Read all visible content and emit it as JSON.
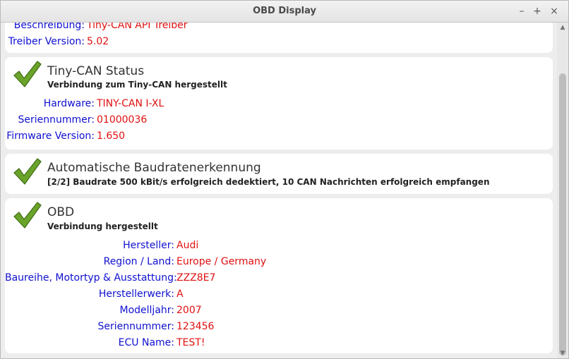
{
  "window": {
    "title": "OBD Display",
    "minimize": "–",
    "maximize": "+",
    "close": "×"
  },
  "driver": {
    "rows": [
      {
        "label": "Beschreibung:",
        "value": "Tiny-CAN API Treiber"
      },
      {
        "label": "Treiber Version:",
        "value": "5.02"
      }
    ]
  },
  "tinycan": {
    "title": "Tiny-CAN Status",
    "subtitle": "Verbindung zum Tiny-CAN hergestellt",
    "rows": [
      {
        "label": "Hardware:",
        "value": "TINY-CAN I-XL"
      },
      {
        "label": "Seriennummer:",
        "value": "01000036"
      },
      {
        "label": "Firmware Version:",
        "value": "1.650"
      }
    ]
  },
  "baud": {
    "title": "Automatische Baudratenerkennung",
    "subtitle": "[2/2] Baudrate 500 kBit/s erfolgreich dedektiert, 10 CAN Nachrichten erfolgreich empfangen"
  },
  "obd": {
    "title": "OBD",
    "subtitle": "Verbindung hergestellt",
    "rows": [
      {
        "label": "Hersteller:",
        "value": "Audi"
      },
      {
        "label": "Region / Land:",
        "value": "Europe / Germany"
      },
      {
        "label": "Baureihe, Motortyp & Ausstattung:",
        "value": "ZZZ8E7"
      },
      {
        "label": "Herstellerwerk:",
        "value": "A"
      },
      {
        "label": "Modelljahr:",
        "value": "2007"
      },
      {
        "label": "Seriennummer:",
        "value": "123456"
      },
      {
        "label": "ECU Name:",
        "value": "TEST!"
      }
    ]
  },
  "icons": {
    "status": "checkmark-icon"
  },
  "colors": {
    "label": "#1010d0",
    "value": "#e01010",
    "check": "#6aa32a"
  }
}
